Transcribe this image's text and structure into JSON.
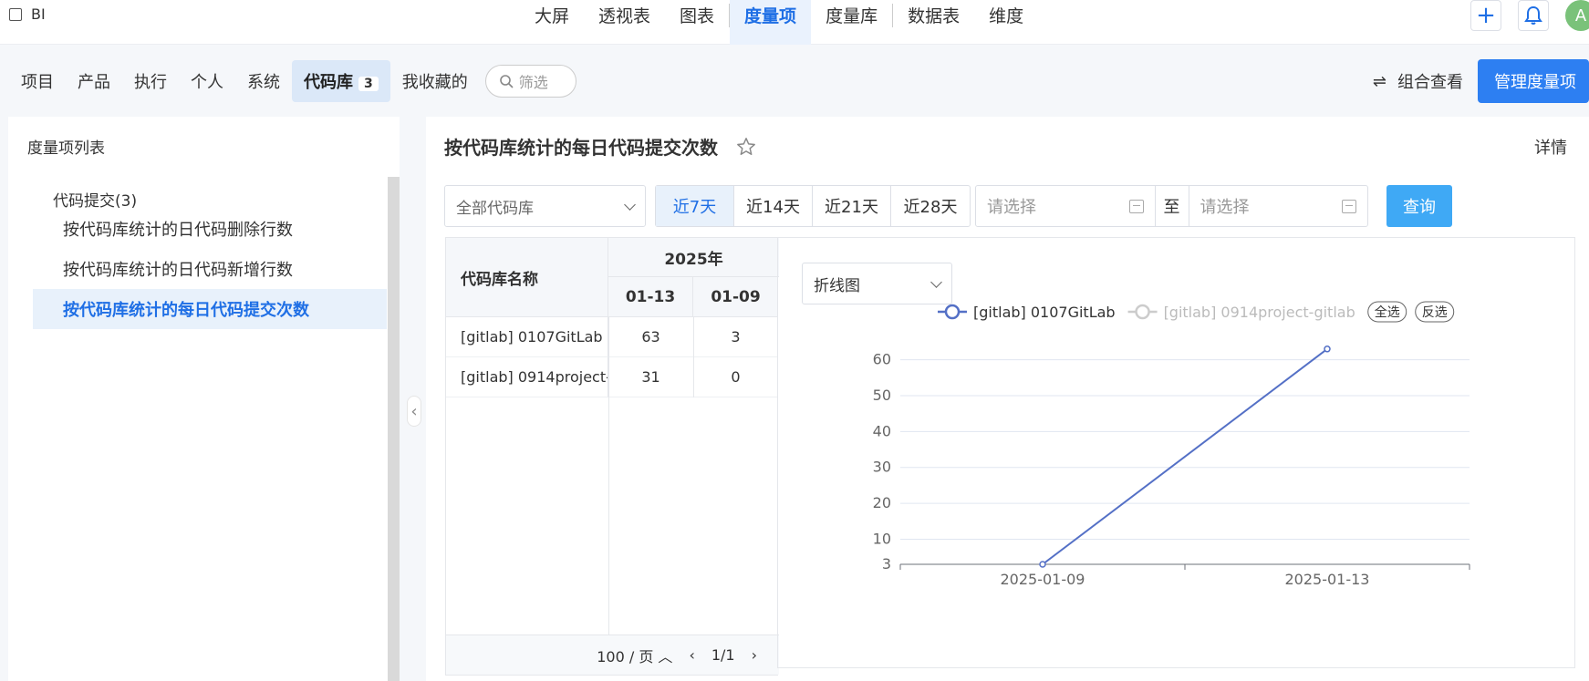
{
  "topbar": {
    "brand": "BI",
    "nav": [
      "大屏",
      "透视表",
      "图表",
      "度量项",
      "度量库",
      "数据表",
      "维度"
    ],
    "active_nav": "度量项",
    "add_icon": "plus-icon",
    "bell_icon": "bell-icon",
    "avatar": "A"
  },
  "subbar": {
    "tabs": [
      "项目",
      "产品",
      "执行",
      "个人",
      "系统",
      "代码库",
      "我收藏的"
    ],
    "active_tab": "代码库",
    "active_badge": "3",
    "filter_placeholder": "筛选",
    "combo_label": "组合查看",
    "manage_label": "管理度量项"
  },
  "left": {
    "title": "度量项列表",
    "group": "代码提交(3)",
    "items": [
      "按代码库统计的日代码删除行数",
      "按代码库统计的日代码新增行数",
      "按代码库统计的每日代码提交次数"
    ],
    "active_index": 2
  },
  "main": {
    "title": "按代码库统计的每日代码提交次数",
    "detail": "详情",
    "repo_select": "全部代码库",
    "ranges": [
      "近7天",
      "近14天",
      "近21天",
      "近28天"
    ],
    "active_range": "近7天",
    "date_start_placeholder": "请选择",
    "date_to": "至",
    "date_end_placeholder": "请选择",
    "query": "查询"
  },
  "table": {
    "name_header": "代码库名称",
    "year_header": "2025年",
    "date_headers": [
      "01-13",
      "01-09"
    ],
    "rows": [
      {
        "name": "[gitlab] 0107GitLab",
        "values": [
          "63",
          "3"
        ]
      },
      {
        "name": "[gitlab] 0914project-gitlab",
        "values": [
          "31",
          "0"
        ]
      }
    ],
    "page_size": "100 / 页",
    "page": "1/1"
  },
  "chart_data": {
    "type": "line",
    "chart_type_label": "折线图",
    "x": [
      "2025-01-09",
      "2025-01-13"
    ],
    "series": [
      {
        "name": "[gitlab] 0107GitLab",
        "values": [
          3,
          63
        ],
        "color": "#5470c6",
        "visible": true
      },
      {
        "name": "[gitlab] 0914project-gitlab",
        "values": [
          0,
          31
        ],
        "color": "#cccccc",
        "visible": false
      }
    ],
    "legend_actions": [
      "全选",
      "反选"
    ],
    "yticks": [
      3,
      10,
      20,
      30,
      40,
      50,
      60
    ],
    "ylim": [
      3,
      66
    ],
    "grid": true,
    "legend_position": "top-center"
  }
}
